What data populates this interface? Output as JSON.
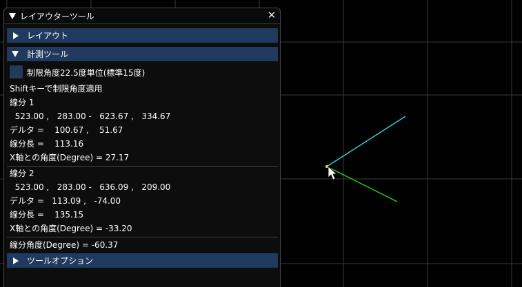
{
  "panel": {
    "title": "レイアウターツール",
    "close_icon": "close-icon"
  },
  "sections": {
    "layout": {
      "label": "レイアウト",
      "expanded": false
    },
    "measure": {
      "label": "計測ツール",
      "expanded": true
    },
    "tool_options": {
      "label": "ツールオプション",
      "expanded": false
    }
  },
  "measure": {
    "limit_checkbox": {
      "label": "制限角度22.5度単位(標準15度)",
      "checked": false
    },
    "shift_hint": "Shiftキーで制限角度適用",
    "segment1": {
      "title": "線分 1",
      "coords": "  523.00 ,   283.00 -   623.67 ,   334.67",
      "delta": "デルタ =    100.67 ,    51.67",
      "length": "線分長 =    113.16",
      "angle": "X軸との角度(Degree) = 27.17"
    },
    "segment2": {
      "title": "線分 2",
      "coords": "  523.00 ,   283.00 -   636.09 ,   209.00",
      "delta": "デルタ =   113.09 ,   -74.00",
      "length": "線分長 =    135.15",
      "angle": "X軸との角度(Degree) = -33.20"
    },
    "segment_angle": "線分角度(Degree) = -60.37"
  },
  "colors": {
    "background": "#000000",
    "grid": "#3a3a3a",
    "header_bg": "#1f3a5e",
    "segment1_line": "#36d6e6",
    "segment2_line": "#22d822"
  }
}
